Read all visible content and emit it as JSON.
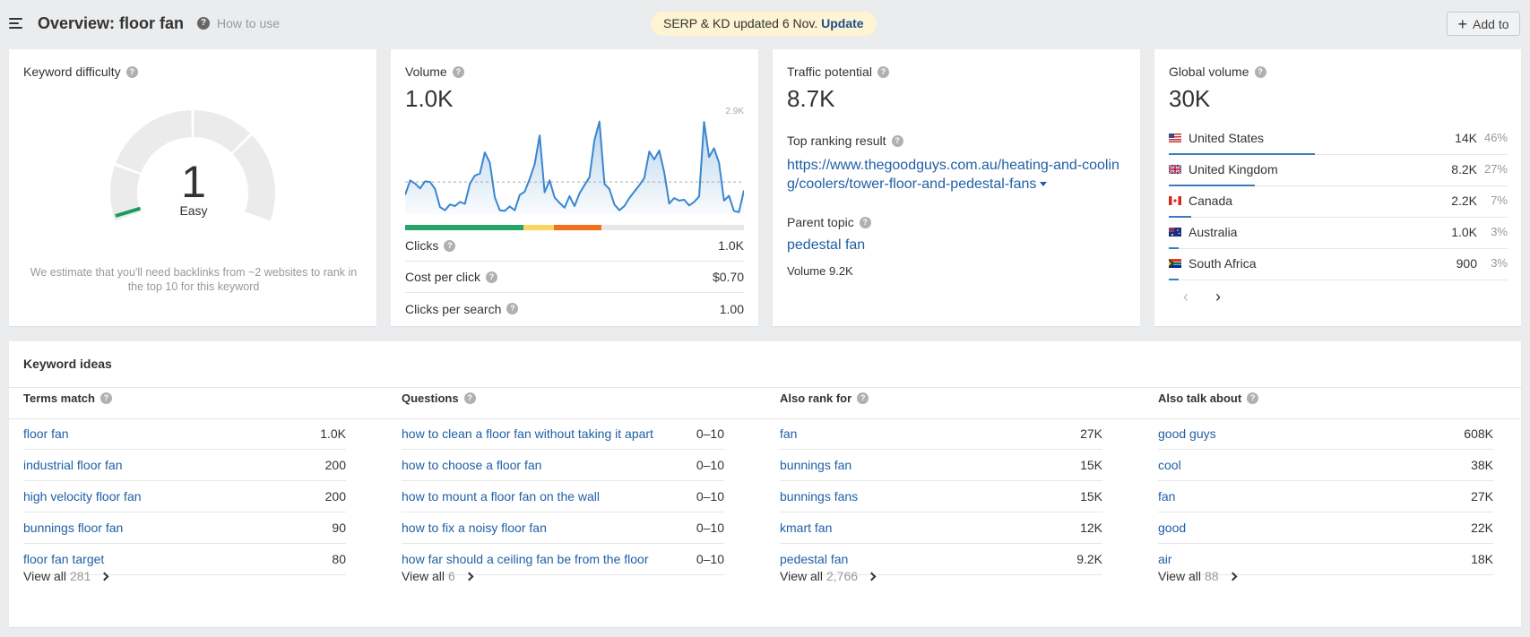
{
  "header": {
    "title": "Overview: floor fan",
    "help_label": "How to use",
    "banner_text": "SERP & KD updated 6 Nov.",
    "banner_link": "Update",
    "add_to_label": "Add to"
  },
  "keyword_difficulty": {
    "label": "Keyword difficulty",
    "value": "1",
    "value_number": 1,
    "max": 100,
    "level": "Easy",
    "note": "We estimate that you'll need backlinks from ~2 websites to rank in the top 10 for this keyword",
    "indicator_color": "#1a9b5c"
  },
  "volume": {
    "label": "Volume",
    "value": "1.0K",
    "chart_max_label": "2.9K",
    "chart_max": 2900,
    "average": 1000,
    "trend": [
      600,
      1050,
      950,
      800,
      1020,
      1000,
      780,
      220,
      120,
      300,
      250,
      380,
      320,
      950,
      1200,
      1260,
      1920,
      1600,
      520,
      120,
      100,
      240,
      120,
      600,
      700,
      1100,
      1550,
      2450,
      680,
      1050,
      520,
      350,
      200,
      560,
      250,
      650,
      900,
      1150,
      2300,
      2880,
      940,
      780,
      300,
      120,
      250,
      500,
      700,
      900,
      1120,
      1950,
      1700,
      1980,
      1300,
      330,
      500,
      420,
      450,
      270,
      380,
      550,
      2870,
      1780,
      2050,
      1600,
      420,
      570,
      100,
      60,
      740
    ],
    "clicks_distribution": [
      {
        "name": "organic",
        "percent": 35,
        "color": "#28a46b"
      },
      {
        "name": "organic-other",
        "percent": 9,
        "color": "#f9d562"
      },
      {
        "name": "paid",
        "percent": 14,
        "color": "#f26f1d"
      },
      {
        "name": "no-clicks",
        "percent": 42,
        "color": "#e8e8e8"
      }
    ],
    "stats": [
      {
        "label": "Clicks",
        "value": "1.0K"
      },
      {
        "label": "Cost per click",
        "value": "$0.70"
      },
      {
        "label": "Clicks per search",
        "value": "1.00"
      }
    ]
  },
  "traffic_potential": {
    "label": "Traffic potential",
    "value": "8.7K",
    "top_result_label": "Top ranking result",
    "top_result_url": "https://www.thegoodguys.com.au/heating-and-cooling/coolers/tower-floor-and-pedestal-fans",
    "parent_topic_label": "Parent topic",
    "parent_topic": "pedestal fan",
    "parent_volume": "Volume 9.2K"
  },
  "global_volume": {
    "label": "Global volume",
    "value": "30K",
    "countries": [
      {
        "name": "United States",
        "volume": "14K",
        "percent": "46%",
        "share": 46,
        "flag": "us"
      },
      {
        "name": "United Kingdom",
        "volume": "8.2K",
        "percent": "27%",
        "share": 27,
        "flag": "gb"
      },
      {
        "name": "Canada",
        "volume": "2.2K",
        "percent": "7%",
        "share": 7,
        "flag": "ca"
      },
      {
        "name": "Australia",
        "volume": "1.0K",
        "percent": "3%",
        "share": 3,
        "flag": "au"
      },
      {
        "name": "South Africa",
        "volume": "900",
        "percent": "3%",
        "share": 3,
        "flag": "za"
      }
    ],
    "prev_icon": "chevron-left-icon",
    "next_icon": "chevron-right-icon"
  },
  "keyword_ideas": {
    "title": "Keyword ideas",
    "view_all_label": "View all",
    "columns": [
      {
        "title": "Terms match",
        "view_all_count": "281",
        "rows": [
          {
            "kw": "floor fan",
            "v": "1.0K"
          },
          {
            "kw": "industrial floor fan",
            "v": "200"
          },
          {
            "kw": "high velocity floor fan",
            "v": "200"
          },
          {
            "kw": "bunnings floor fan",
            "v": "90"
          },
          {
            "kw": "floor fan target",
            "v": "80"
          }
        ]
      },
      {
        "title": "Questions",
        "view_all_count": "6",
        "rows": [
          {
            "kw": "how to clean a floor fan without taking it apart",
            "v": "0–10"
          },
          {
            "kw": "how to choose a floor fan",
            "v": "0–10"
          },
          {
            "kw": "how to mount a floor fan on the wall",
            "v": "0–10"
          },
          {
            "kw": "how to fix a noisy floor fan",
            "v": "0–10"
          },
          {
            "kw": "how far should a ceiling fan be from the floor",
            "v": "0–10"
          }
        ]
      },
      {
        "title": "Also rank for",
        "view_all_count": "2,766",
        "rows": [
          {
            "kw": "fan",
            "v": "27K"
          },
          {
            "kw": "bunnings fan",
            "v": "15K"
          },
          {
            "kw": "bunnings fans",
            "v": "15K"
          },
          {
            "kw": "kmart fan",
            "v": "12K"
          },
          {
            "kw": "pedestal fan",
            "v": "9.2K"
          }
        ]
      },
      {
        "title": "Also talk about",
        "view_all_count": "88",
        "rows": [
          {
            "kw": "good guys",
            "v": "608K"
          },
          {
            "kw": "cool",
            "v": "38K"
          },
          {
            "kw": "fan",
            "v": "27K"
          },
          {
            "kw": "good",
            "v": "22K"
          },
          {
            "kw": "air",
            "v": "18K"
          }
        ]
      }
    ]
  },
  "colors": {
    "link": "#1f5fa6",
    "accent_bar": "#3a7bbf",
    "chart_line": "#3a86cf",
    "banner_bg": "#fcf4d2"
  }
}
